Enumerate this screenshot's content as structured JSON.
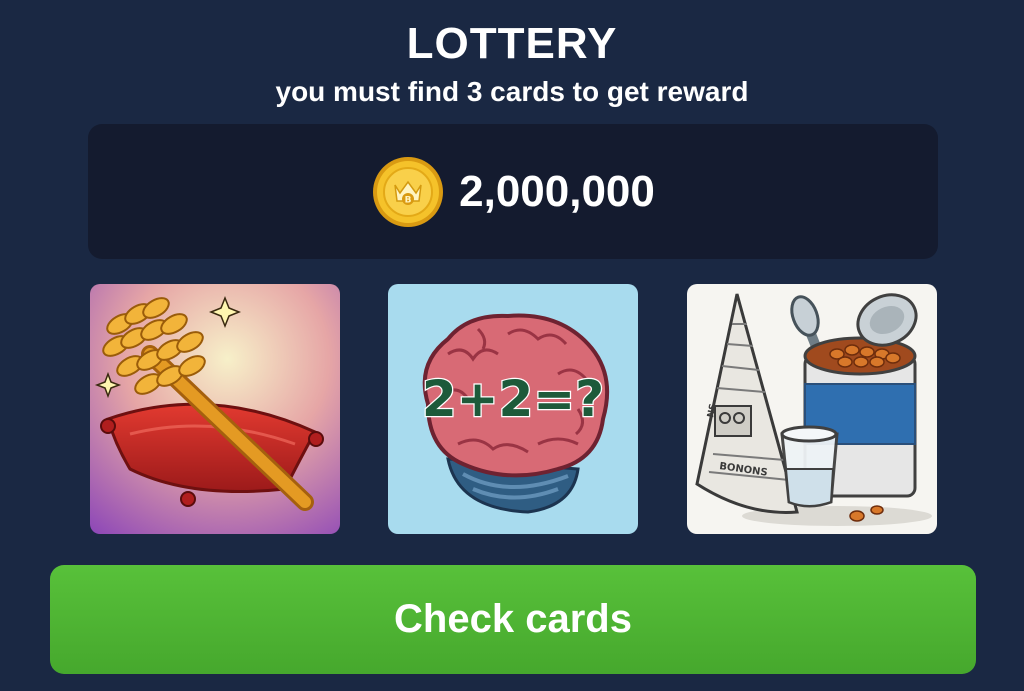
{
  "header": {
    "title": "LOTTERY",
    "subtitle": "you must find 3 cards to get reward"
  },
  "reward": {
    "icon": "coin-icon",
    "amount": "2,000,000"
  },
  "cards": [
    {
      "picture": "toilet-brush-on-cushion-card"
    },
    {
      "picture": "brain-math-card",
      "text": "2+2=?"
    },
    {
      "picture": "newspaper-beans-glass-card",
      "text": "NS"
    }
  ],
  "actions": {
    "check_label": "Check cards"
  },
  "colors": {
    "background": "#1a2843",
    "panel": "#141b2f",
    "button": "#4fb534",
    "coin": "#f2b91c",
    "text": "#ffffff"
  }
}
